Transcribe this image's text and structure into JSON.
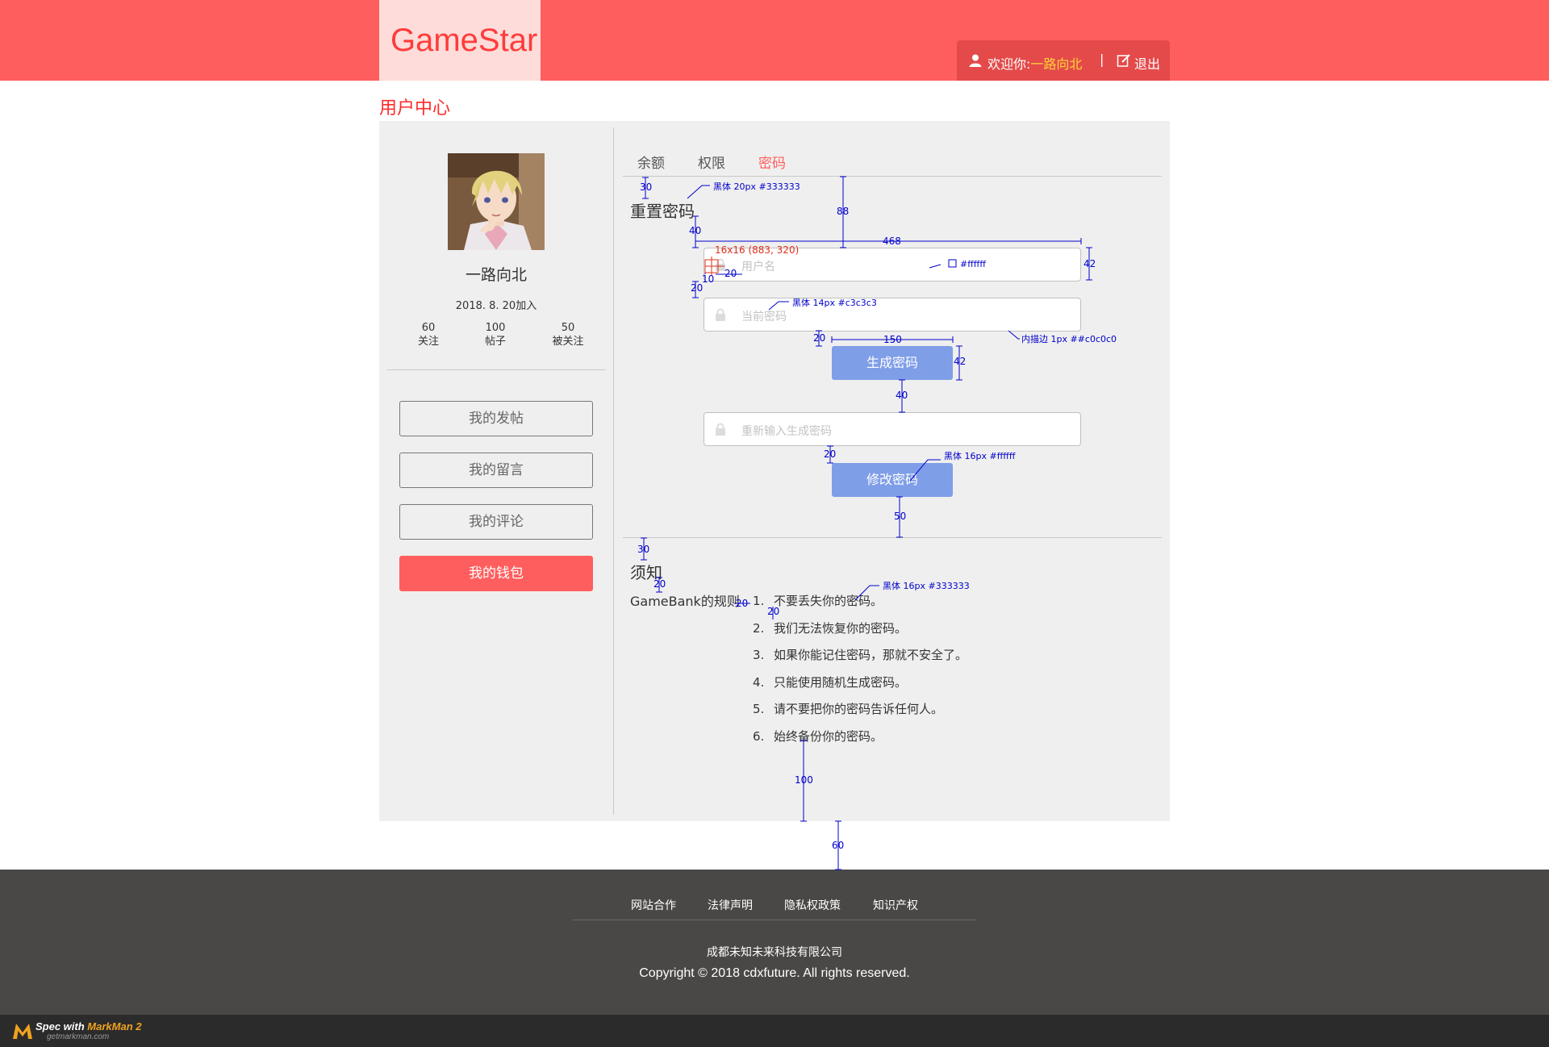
{
  "header": {
    "logo": "GameStar",
    "welcome_prefix": "欢迎你:",
    "username": "一路向北",
    "separator": "|",
    "logout": "退出"
  },
  "page_title": "用户中心",
  "profile": {
    "name": "一路向北",
    "join_date": "2018. 8. 20加入",
    "stats": [
      {
        "value": "60",
        "label": "关注"
      },
      {
        "value": "100",
        "label": "帖子"
      },
      {
        "value": "50",
        "label": "被关注"
      }
    ]
  },
  "sidebar_menu": [
    "我的发帖",
    "我的留言",
    "我的评论",
    "我的钱包"
  ],
  "tabs": [
    "余额",
    "权限",
    "密码"
  ],
  "reset": {
    "title": "重置密码",
    "username_placeholder": "用户名",
    "current_password_placeholder": "当前密码",
    "generate_button": "生成密码",
    "reenter_placeholder": "重新输入生成密码",
    "change_button": "修改密码"
  },
  "notice": {
    "title": "须知",
    "rules_label": "GameBank的规则",
    "rules": [
      {
        "num": "1.",
        "text": "不要丢失你的密码。"
      },
      {
        "num": "2.",
        "text": "我们无法恢复你的密码。"
      },
      {
        "num": "3.",
        "text": "如果你能记住密码，那就不安全了。"
      },
      {
        "num": "4.",
        "text": "只能使用随机生成密码。"
      },
      {
        "num": "5.",
        "text": "请不要把你的密码告诉任何人。"
      },
      {
        "num": "6.",
        "text": "始终备份你的密码。"
      }
    ]
  },
  "footer": {
    "links": [
      "网站合作",
      "法律声明",
      "隐私权政策",
      "知识产权"
    ],
    "company": "成都未知未来科技有限公司",
    "copyright": "Copyright © 2018 cdxfuture. All rights reserved."
  },
  "markman": {
    "label_prefix": "Spec with ",
    "label_brand": "MarkMan 2",
    "site": "getmarkman.com"
  },
  "annotations": {
    "title_font": "黑体  20px  #333333",
    "d30a": "30",
    "d88": "88",
    "d40a": "40",
    "d468": "468",
    "icon_pos": "16x16 (883, 320)",
    "bg_spec": "#ffffff",
    "d42a": "42",
    "d10": "10",
    "d20icon": "20",
    "d20a": "20",
    "ph_font": "黑体  14px  #c3c3c3",
    "border_spec": "内描边  1px  ##c0c0c0",
    "d20b": "20",
    "d150": "150",
    "d42b": "42",
    "d40b": "40",
    "d20c": "20",
    "btn_font": "黑体  16px  #ffffff",
    "d50": "50",
    "d30b": "30",
    "d20d": "20",
    "d20e": "20",
    "d20f": "20",
    "rule_font": "黑体  16px  #333333",
    "d100": "100",
    "d60": "60",
    "accent_color": "#ff5e5e",
    "annotation_color": "#0000cc"
  }
}
